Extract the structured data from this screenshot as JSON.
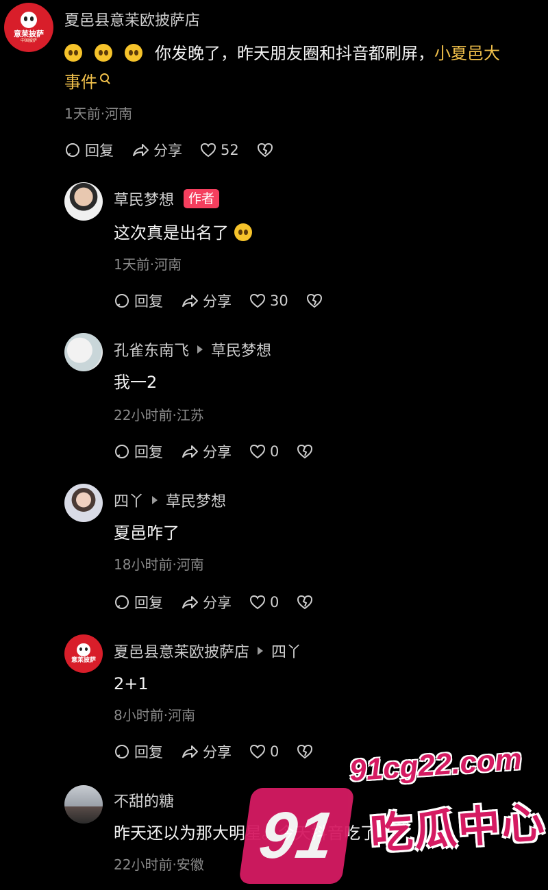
{
  "comments": [
    {
      "name": "夏邑县意苿欧披萨店",
      "avatar": "brand-logo",
      "text_before": "你发晚了，昨天朋友圈和抖音都刷屏，",
      "text_link": "小夏邑大",
      "text_link2": "事件",
      "meta": "1天前·河南",
      "likes": "52"
    },
    {
      "name": "草民梦想",
      "badge": "作者",
      "avatar": "photo",
      "text": "这次真是出名了",
      "meta": "1天前·河南",
      "likes": "30"
    },
    {
      "name": "孔雀东南飞",
      "reply_to": "草民梦想",
      "avatar": "photo",
      "text": "我一2",
      "meta": "22小时前·江苏",
      "likes": "0"
    },
    {
      "name": "四丫",
      "reply_to": "草民梦想",
      "avatar": "photo",
      "text": "夏邑咋了",
      "meta": "18小时前·河南",
      "likes": "0"
    },
    {
      "name": "夏邑县意苿欧披萨店",
      "reply_to": "四丫",
      "avatar": "brand-logo",
      "text": "2+1",
      "meta": "8小时前·河南",
      "likes": "0"
    },
    {
      "name": "不甜的糖",
      "avatar": "photo",
      "text": "昨天还以为那大明星。今天抖音吃了",
      "meta": "22小时前·安徽"
    }
  ],
  "labels": {
    "reply": "回复",
    "share": "分享"
  },
  "brand_logo": {
    "text": "意苿披萨",
    "sub": "中国披萨"
  },
  "watermark": {
    "number": "91",
    "domain": "91cg22.com",
    "title": "吃瓜中心"
  },
  "colors": {
    "background": "#000000",
    "highlight": "#f2c14b",
    "author_badge": "#f43f5e",
    "watermark": "#d51b62"
  },
  "icons": [
    "reply-icon",
    "share-icon",
    "heart-icon",
    "dislike-icon",
    "search-icon",
    "emoji-icon"
  ]
}
